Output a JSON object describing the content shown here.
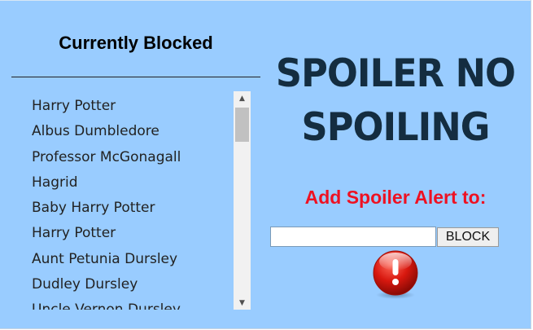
{
  "blocked_panel": {
    "title": "Currently Blocked",
    "items": [
      "Harry Potter",
      "Albus Dumbledore",
      "Professor McGonagall",
      "Hagrid",
      "Baby Harry Potter",
      "Harry Potter",
      "Aunt Petunia Dursley",
      "Dudley Dursley",
      "Uncle Vernon Dursley"
    ]
  },
  "headline": {
    "line1": "SPOILER NO",
    "line2": "SPOILING"
  },
  "add_form": {
    "label": "Add Spoiler Alert to:",
    "input_value": "",
    "button_label": "BLOCK"
  },
  "colors": {
    "background": "#99ccff",
    "headline": "#142d40",
    "label_red": "#ee1122",
    "alert_icon": "#cc1111"
  },
  "icons": {
    "alert": "exclamation-circle-icon",
    "scroll_up": "triangle-up-icon",
    "scroll_down": "triangle-down-icon"
  }
}
